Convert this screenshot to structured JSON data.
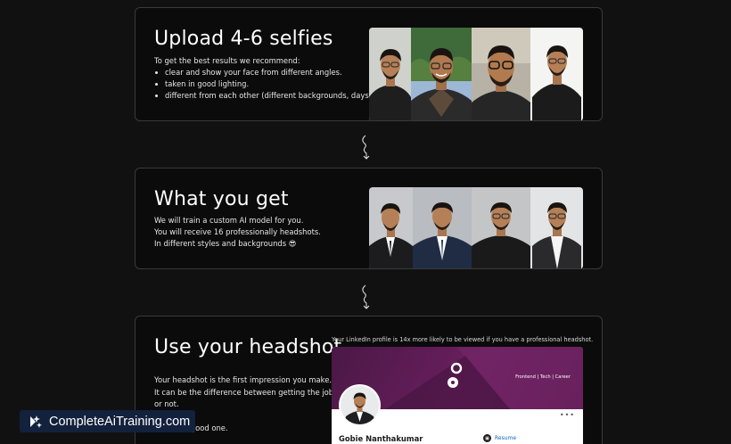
{
  "steps": [
    {
      "title": "Upload 4-6 selfies",
      "intro": "To get the best results we recommend:",
      "bullets": [
        "clear and show your face from different angles.",
        "taken in good lighting.",
        "different from each other (different backgrounds, days)"
      ]
    },
    {
      "title": "What you get",
      "lines": [
        "We will train a custom AI model for you.",
        "You will receive 16 professionally headshots.",
        "In different styles and backgrounds 😎"
      ]
    },
    {
      "title": "Use your headshot",
      "lines": [
        "Your headshot is the first impression you make.",
        "It can be the difference between getting the job",
        "or not.",
        "Make it a good one."
      ],
      "linkedin_caption": "Your LinkedIn profile is 14x more likely to be viewed if you have a professional headshot.",
      "linkedin_preview": {
        "banner_tagline": "Frontend | Tech | Career",
        "more_label": "•••",
        "name": "Gobie Nanthakumar",
        "resume_label": "Resume"
      }
    }
  ],
  "watermark": {
    "text": "CompleteAiTraining.com",
    "icon": "sparkle-icon"
  },
  "colors": {
    "page_background": "#111111",
    "card_border": "#3a3a3a",
    "linkedin_banner": "#5a1a50",
    "linkedin_link": "#0a66c2",
    "watermark_background": "#13213d"
  }
}
